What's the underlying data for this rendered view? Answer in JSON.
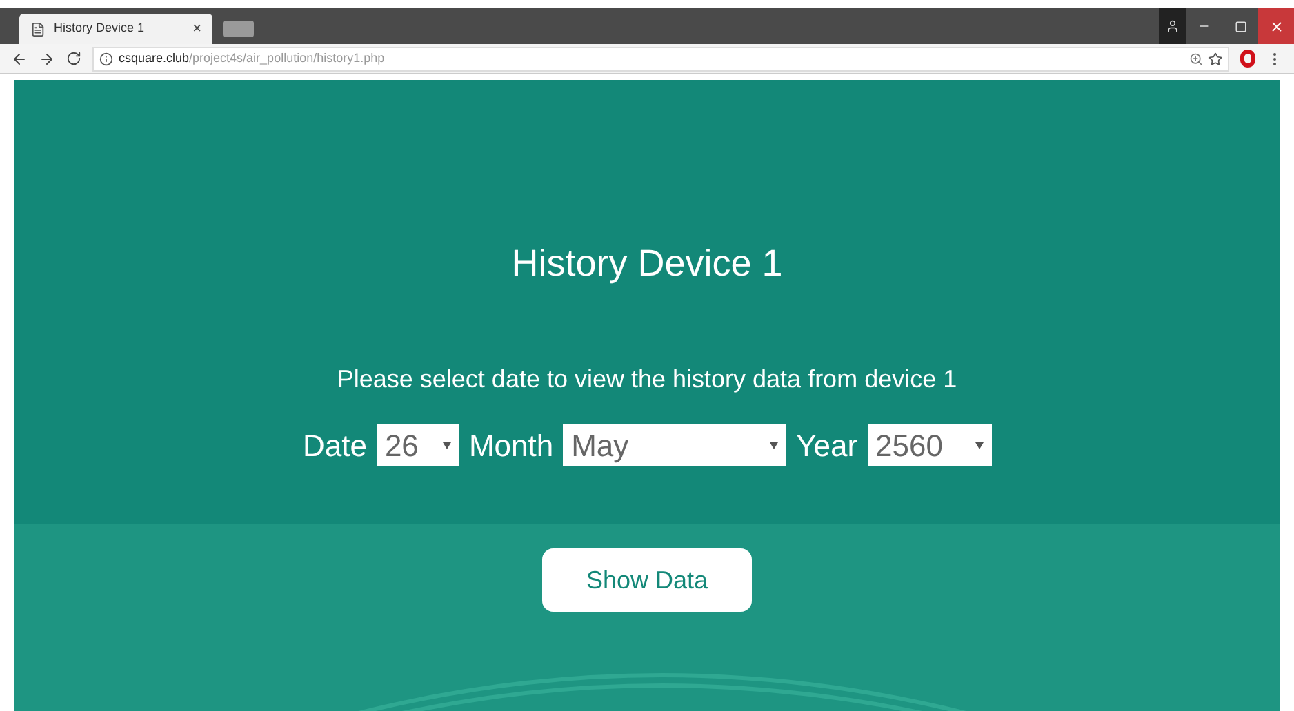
{
  "browser": {
    "tab": {
      "title": "History Device 1",
      "close": "×"
    },
    "url": {
      "host": "csquare.club",
      "path": "/project4s/air_pollution/history1.php"
    }
  },
  "page": {
    "title": "History Device 1",
    "instruction": "Please select date to view the history data from device 1",
    "selects": [
      {
        "label": "Date",
        "value": "26"
      },
      {
        "label": "Month",
        "value": "May"
      },
      {
        "label": "Year",
        "value": "2560"
      }
    ],
    "button": "Show Data"
  }
}
